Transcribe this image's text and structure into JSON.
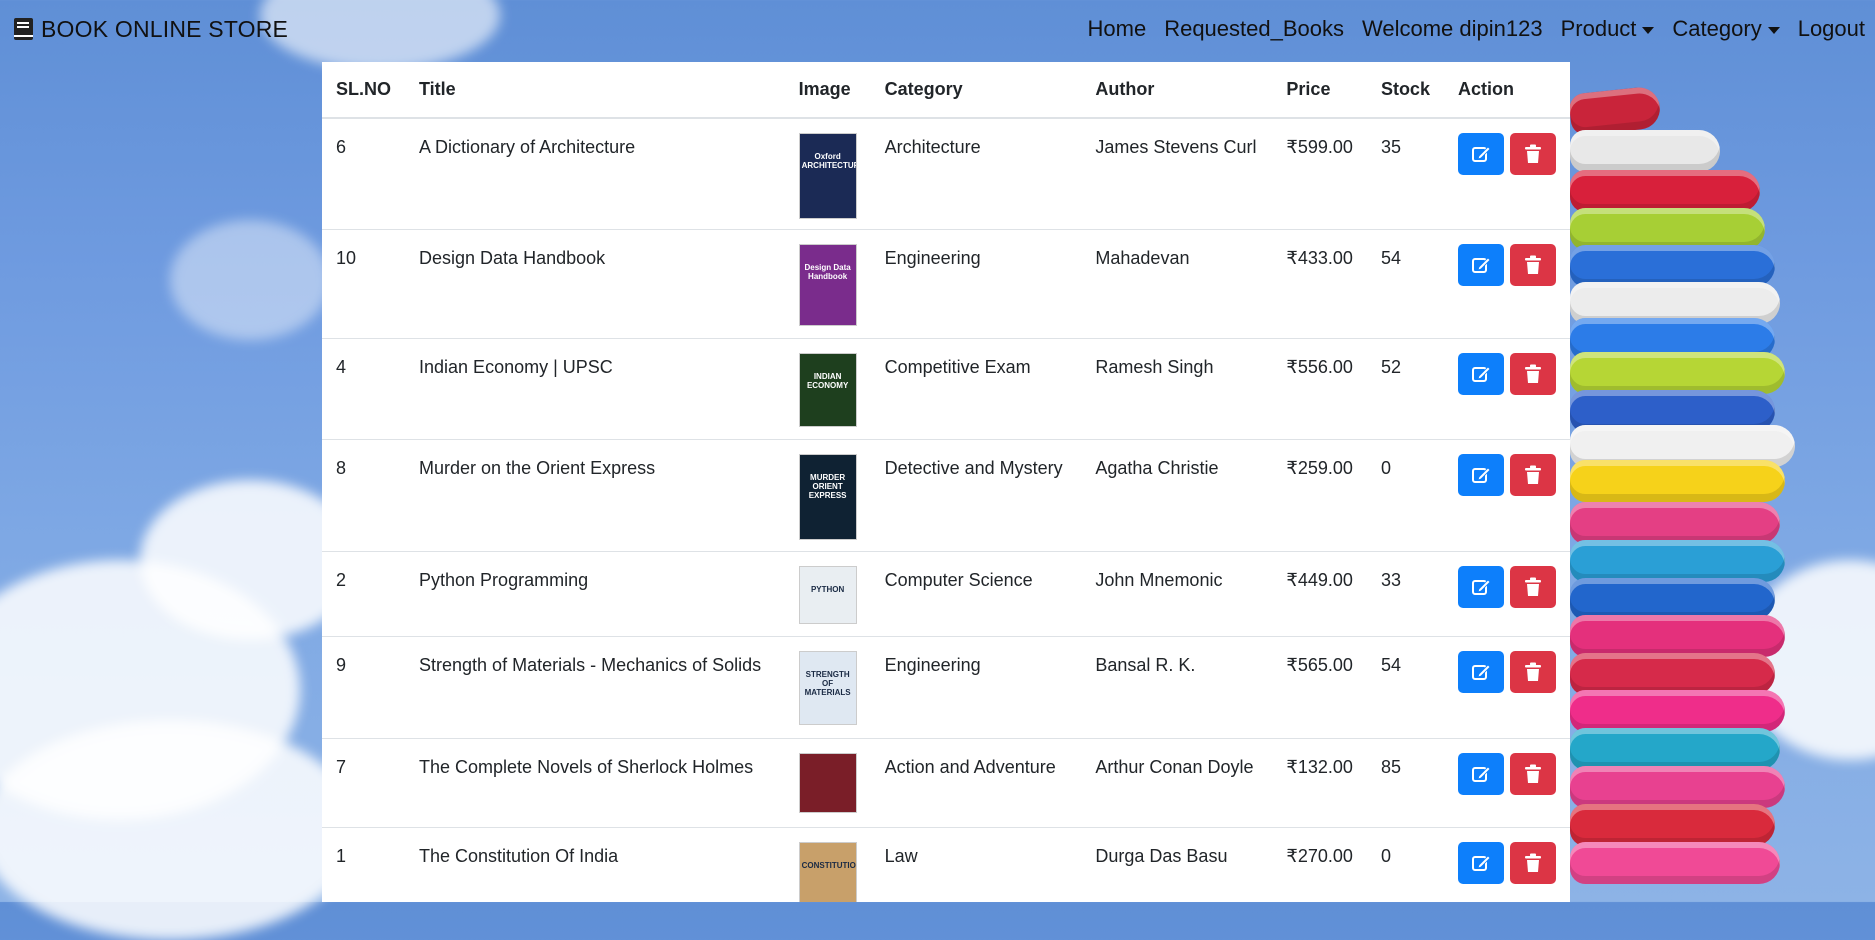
{
  "brand": {
    "name": "BOOK ONLINE STORE",
    "icon": "book-icon"
  },
  "nav": {
    "home": "Home",
    "requested": "Requested_Books",
    "welcome": "Welcome dipin123",
    "product": "Product",
    "category": "Category",
    "logout": "Logout"
  },
  "table": {
    "headers": [
      "SL.NO",
      "Title",
      "Image",
      "Category",
      "Author",
      "Price",
      "Stock",
      "Action"
    ],
    "rows": [
      {
        "sl": "6",
        "title": "A Dictionary of Architecture",
        "category": "Architecture",
        "author": "James Stevens Curl",
        "price": "₹599.00",
        "stock": "35",
        "cover_text": "Oxford ARCHITECTURE",
        "cover_color": "#1b2a55"
      },
      {
        "sl": "10",
        "title": "Design Data Handbook",
        "category": "Engineering",
        "author": "Mahadevan",
        "price": "₹433.00",
        "stock": "54",
        "cover_text": "Design Data Handbook",
        "cover_color": "#7a2c8c"
      },
      {
        "sl": "4",
        "title": "Indian Economy | UPSC",
        "category": "Competitive Exam",
        "author": "Ramesh Singh",
        "price": "₹556.00",
        "stock": "52",
        "cover_text": "INDIAN ECONOMY",
        "cover_color": "#1e3f1e"
      },
      {
        "sl": "8",
        "title": "Murder on the Orient Express",
        "category": "Detective and Mystery",
        "author": "Agatha Christie",
        "price": "₹259.00",
        "stock": "0",
        "cover_text": "MURDER ORIENT EXPRESS",
        "cover_color": "#0f2233"
      },
      {
        "sl": "2",
        "title": "Python Programming",
        "category": "Computer Science",
        "author": "John Mnemonic",
        "price": "₹449.00",
        "stock": "33",
        "cover_text": "PYTHON",
        "cover_color": "#e9eef2"
      },
      {
        "sl": "9",
        "title": "Strength of Materials - Mechanics of Solids",
        "category": "Engineering",
        "author": "Bansal R. K.",
        "price": "₹565.00",
        "stock": "54",
        "cover_text": "STRENGTH OF MATERIALS",
        "cover_color": "#dfe8f2"
      },
      {
        "sl": "7",
        "title": "The Complete Novels of Sherlock Holmes",
        "category": "Action and Adventure",
        "author": "Arthur Conan Doyle",
        "price": "₹132.00",
        "stock": "85",
        "cover_text": "",
        "cover_color": "#7a1e28"
      },
      {
        "sl": "1",
        "title": "The Constitution Of India",
        "category": "Law",
        "author": "Durga Das Basu",
        "price": "₹270.00",
        "stock": "0",
        "cover_text": "CONSTITUTION",
        "cover_color": "#c8a06a"
      }
    ]
  },
  "colors": {
    "edit": "#0d7ffb",
    "delete": "#dc3545"
  },
  "icons": {
    "edit": "edit-icon",
    "delete": "trash-icon"
  }
}
